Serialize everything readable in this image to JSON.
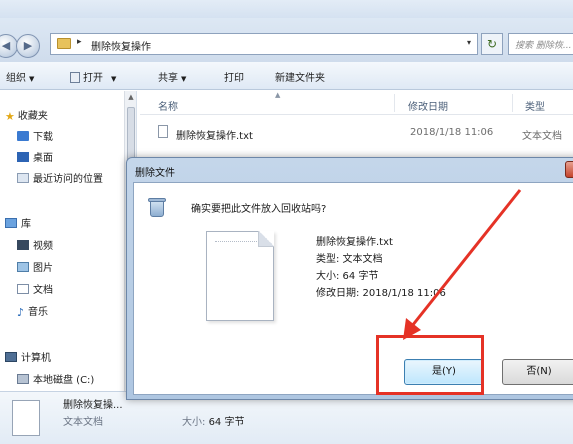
{
  "explorer": {
    "address": {
      "path": "删除恢复操作",
      "separator": "▸",
      "dropdown": "▾",
      "refresh": "↻"
    },
    "search": {
      "placeholder": "搜索 删除恢..."
    },
    "toolbar": {
      "organize": "组织",
      "open": "打开",
      "share": "共享",
      "print": "打印",
      "new_folder": "新建文件夹",
      "dropdown_arrow": "▼"
    },
    "nav": {
      "favorites": "收藏夹",
      "downloads": "下载",
      "desktop": "桌面",
      "recent": "最近访问的位置",
      "libraries": "库",
      "videos": "视频",
      "pictures": "图片",
      "documents": "文档",
      "music": "音乐",
      "computer": "计算机",
      "local_disk": "本地磁盘 (C:)"
    },
    "columns": {
      "name": "名称",
      "date": "修改日期",
      "type": "类型"
    },
    "files": [
      {
        "name": "删除恢复操作.txt",
        "date": "2018/1/18 11:06",
        "type": "文本文档"
      }
    ],
    "details": {
      "name": "删除恢复操...",
      "type": "文本文档",
      "size_label": "大小:",
      "size_value": "64 字节"
    }
  },
  "dialog": {
    "title": "删除文件",
    "close": "x",
    "question": "确实要把此文件放入回收站吗?",
    "file_name": "删除恢复操作.txt",
    "type_line": "类型: 文本文档",
    "size_line": "大小: 64 字节",
    "date_line": "修改日期: 2018/1/18 11:06",
    "yes_label": "是(Y)",
    "no_label": "否(N)"
  },
  "colors": {
    "annotation": "#e53226",
    "dialog_frame": "#aec6e1",
    "yes_button": "#bee6fd"
  }
}
